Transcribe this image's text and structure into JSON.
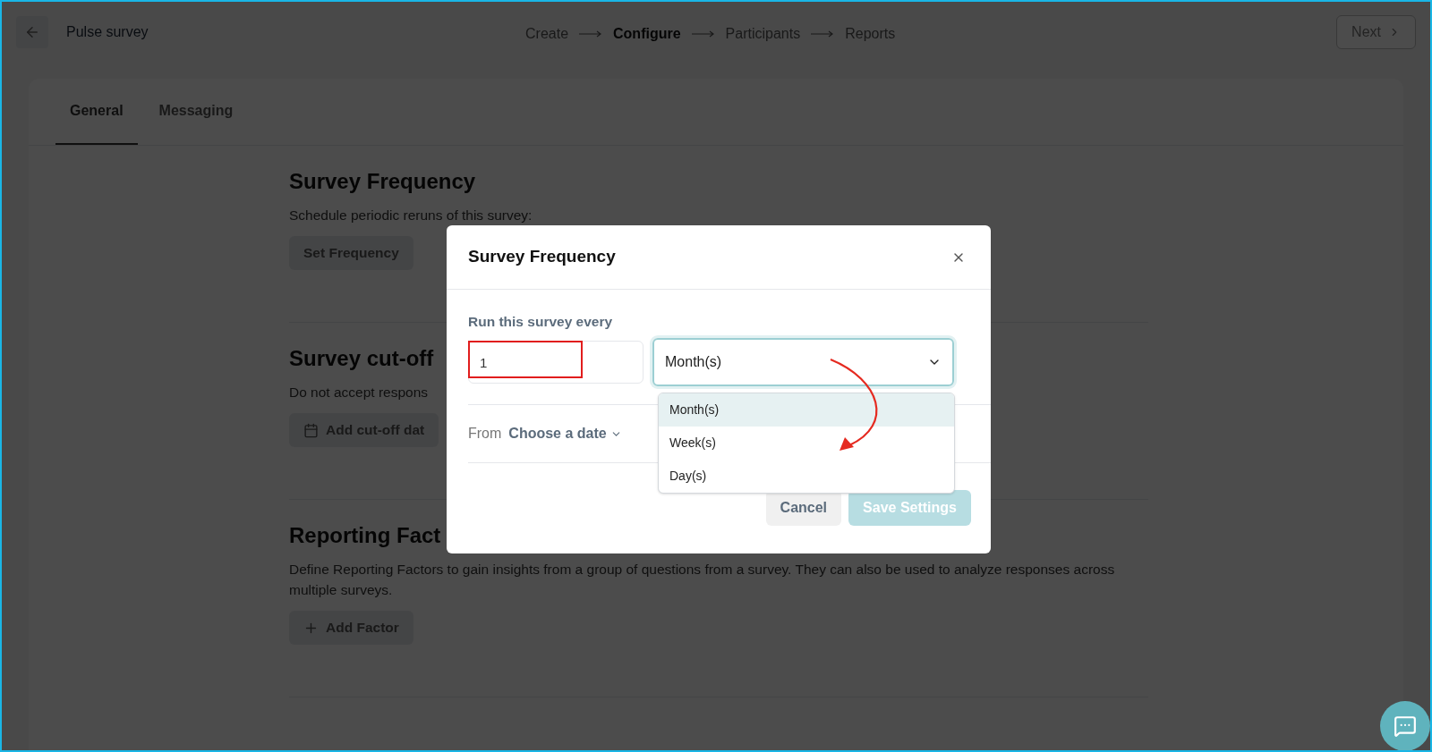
{
  "header": {
    "title": "Pulse survey",
    "steps": [
      {
        "label": "Create",
        "selected": false
      },
      {
        "label": "Configure",
        "selected": true
      },
      {
        "label": "Participants",
        "selected": false
      },
      {
        "label": "Reports",
        "selected": false
      }
    ],
    "next_button": "Next"
  },
  "tabs": [
    {
      "label": "General",
      "selected": true
    },
    {
      "label": "Messaging",
      "selected": false
    }
  ],
  "sections": [
    {
      "title": "Survey Frequency",
      "description": "Schedule periodic reruns of this survey:",
      "button": "Set Frequency",
      "kind": "plain"
    },
    {
      "title": "Survey cut-off",
      "description": "Do not accept respons",
      "button": "Add cut-off dat",
      "kind": "calendar"
    },
    {
      "title": "Reporting Fact",
      "description": "Define Reporting Factors to gain insights from a group of questions from a survey. They can also be used to analyze responses across multiple surveys.",
      "button": "Add Factor",
      "kind": "plus"
    }
  ],
  "modal": {
    "title": "Survey Frequency",
    "label": "Run this survey every",
    "number_value": "1",
    "unit_value": "Month(s)",
    "expanded": true,
    "options": [
      {
        "label": "Month(s)",
        "selected": true
      },
      {
        "label": "Week(s)",
        "selected": false
      },
      {
        "label": "Day(s)",
        "selected": false
      }
    ],
    "from_label": "From",
    "date_picker": "Choose a date",
    "cancel": "Cancel",
    "save": "Save Settings",
    "save_disabled": true
  }
}
